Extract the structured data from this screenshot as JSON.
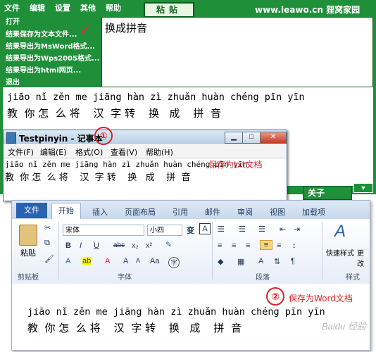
{
  "app": {
    "menu": [
      "文件",
      "编辑",
      "设置",
      "其他",
      "帮助"
    ],
    "paste_button": "粘贴",
    "brand": "www.leawo.cn 狸窝家园",
    "menu_items": [
      "打开",
      "结果保存为文本文件...",
      "结果导出为MsWord格式...",
      "结果导出为Wps2005格式...",
      "结果导出为html网页...",
      "退出"
    ],
    "checkmark": "✓",
    "input_text": "换成拼音",
    "result_pinyin": "jiāo nǐ zěn me jiāng hàn zì zhuǎn huàn chéng pīn yīn",
    "result_hanzi": "教  你 怎  么 将    汉  字 转    换   成    拼  音",
    "close_button": "关子",
    "arrow_button": "▼"
  },
  "notepad": {
    "title": "Testpinyin - 记事本",
    "menu": [
      "文件(F)",
      "编辑(E)",
      "格式(O)",
      "查看(V)",
      "帮助(H)"
    ],
    "pinyin": "jiāo nǐ zěn me jiāng hàn zì zhuǎn huàn chéng pīn yīn",
    "hanzi": "教  你 怎  么 将    汉  字 转    换   成    拼  音",
    "note": "保存为txt文档",
    "controls": {
      "min": "▁",
      "max": "□",
      "close": "✕"
    }
  },
  "annotations": {
    "one": "①",
    "two": "②"
  },
  "word": {
    "file_tab": "文件",
    "tabs": [
      "开始",
      "插入",
      "页面布局",
      "引用",
      "邮件",
      "审阅",
      "视图",
      "加载项"
    ],
    "font_name": "宋体",
    "font_size": "小四",
    "paste_label": "粘贴",
    "groups": {
      "clipboard": "剪贴板",
      "font": "字体",
      "paragraph": "段落",
      "styles": "样式"
    },
    "style_quick": "快速样式",
    "style_change": "更改",
    "format_buttons": [
      "B",
      "I",
      "U",
      "abc",
      "x₂",
      "x²"
    ],
    "doc_pinyin": "jiāo nǐ zěn me jiāng hàn zì zhuǎn huàn chéng pīn yīn",
    "doc_hanzi": "教  你 怎  么 将    汉  字 转    换   成    拼  音",
    "note": "保存为Word文档",
    "watermark": "Baidu 经验"
  }
}
